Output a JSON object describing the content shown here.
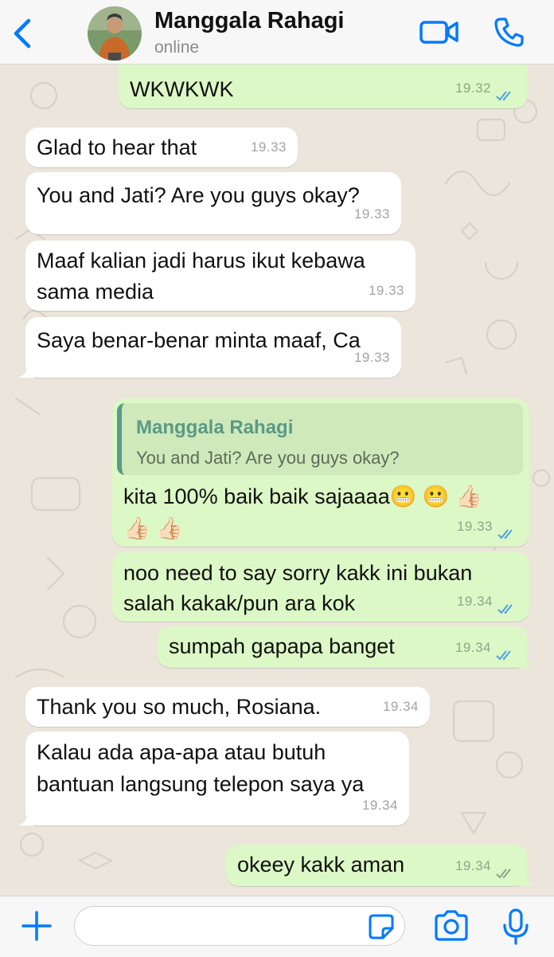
{
  "header": {
    "contact_name": "Manggala Rahagi",
    "status": "online",
    "icons": [
      "chevron-left-icon",
      "avatar",
      "video-camera-icon",
      "phone-icon"
    ]
  },
  "colors": {
    "accent": "#007aff",
    "incoming_bubble": "#ffffff",
    "outgoing_bubble": "#dcf8c6",
    "read_ticks": "#4fa3e0",
    "quote_name": "#5a9a86"
  },
  "messages": [
    {
      "dir": "out",
      "text": "WKWKWK",
      "time": "19.32",
      "read": true
    },
    {
      "dir": "in",
      "text": "Glad to hear that",
      "time": "19.33"
    },
    {
      "dir": "in",
      "text": "You and Jati? Are you guys okay?",
      "time": "19.33"
    },
    {
      "dir": "in",
      "text": "Maaf kalian jadi harus ikut kebawa\nsama media",
      "time": "19.33"
    },
    {
      "dir": "in",
      "text": "Saya benar-benar minta maaf, Ca",
      "time": "19.33"
    },
    {
      "dir": "out",
      "reply_to": {
        "name": "Manggala Rahagi",
        "text": "You and Jati? Are you guys okay?"
      },
      "text": "kita 100% baik baik sajaaaa😬 😬 👍🏻\n👍🏻 👍🏻",
      "time": "19.33",
      "read": true
    },
    {
      "dir": "out",
      "text": "noo need to say sorry kakk ini bukan\nsalah kakak/pun ara kok",
      "time": "19.34",
      "read": true
    },
    {
      "dir": "out",
      "text": "sumpah gapapa banget",
      "time": "19.34",
      "read": true
    },
    {
      "dir": "in",
      "text": "Thank you so much, Rosiana.",
      "time": "19.34"
    },
    {
      "dir": "in",
      "text": "Kalau ada apa-apa atau butuh\nbantuan langsung telepon saya ya",
      "time": "19.34"
    },
    {
      "dir": "out",
      "text": "okeey kakk aman",
      "time": "19.34",
      "read": false
    }
  ],
  "input_bar": {
    "placeholder": "",
    "icons": [
      "plus-icon",
      "sticker-icon",
      "camera-icon",
      "microphone-icon"
    ]
  }
}
